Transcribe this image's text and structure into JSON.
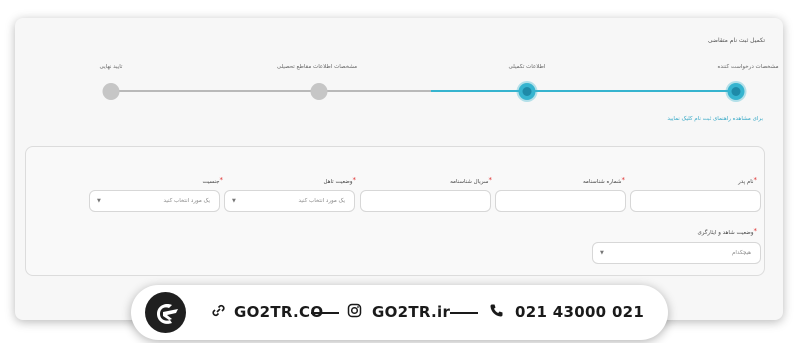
{
  "page": {
    "title": "تکمیل ثبت نام متقاضی"
  },
  "steps": [
    {
      "label": "مشخصات درخواست کننده",
      "state": "active"
    },
    {
      "label": "اطلاعات تکمیلی",
      "state": "active"
    },
    {
      "label": "مشخصات اطلاعات مقاطع تحصیلی",
      "state": "inactive"
    },
    {
      "label": "تایید نهایی",
      "state": "inactive"
    }
  ],
  "guide_link": "برای مشاهده راهنمای ثبت نام کلیک نمایید",
  "form": {
    "father_name": {
      "label": "نام پدر",
      "required": "*",
      "value": ""
    },
    "id_number": {
      "label": "شماره شناسنامه",
      "required": "*",
      "value": ""
    },
    "id_serial": {
      "label": "سریال شناسنامه",
      "required": "*",
      "value": ""
    },
    "marital_status": {
      "label": "وضعیت تاهل",
      "required": "*",
      "selected": "یک مورد انتخاب کنید"
    },
    "gender": {
      "label": "جنسیت",
      "required": "*",
      "selected": "یک مورد انتخاب کنید"
    },
    "veteran_status": {
      "label": "وضعیت شاهد و ایثارگری",
      "required": "*",
      "selected": "هیچکدام"
    }
  },
  "contact_bar": {
    "website": "GO2TR.CO",
    "instagram": "GO2TR.ir",
    "phone": "021 43000 021",
    "icons": [
      "logo-icon",
      "link-icon",
      "instagram-icon",
      "phone-icon"
    ]
  },
  "colors": {
    "accent": "#36b4cf",
    "inactive": "#c6c6c6",
    "required": "#e03030"
  }
}
